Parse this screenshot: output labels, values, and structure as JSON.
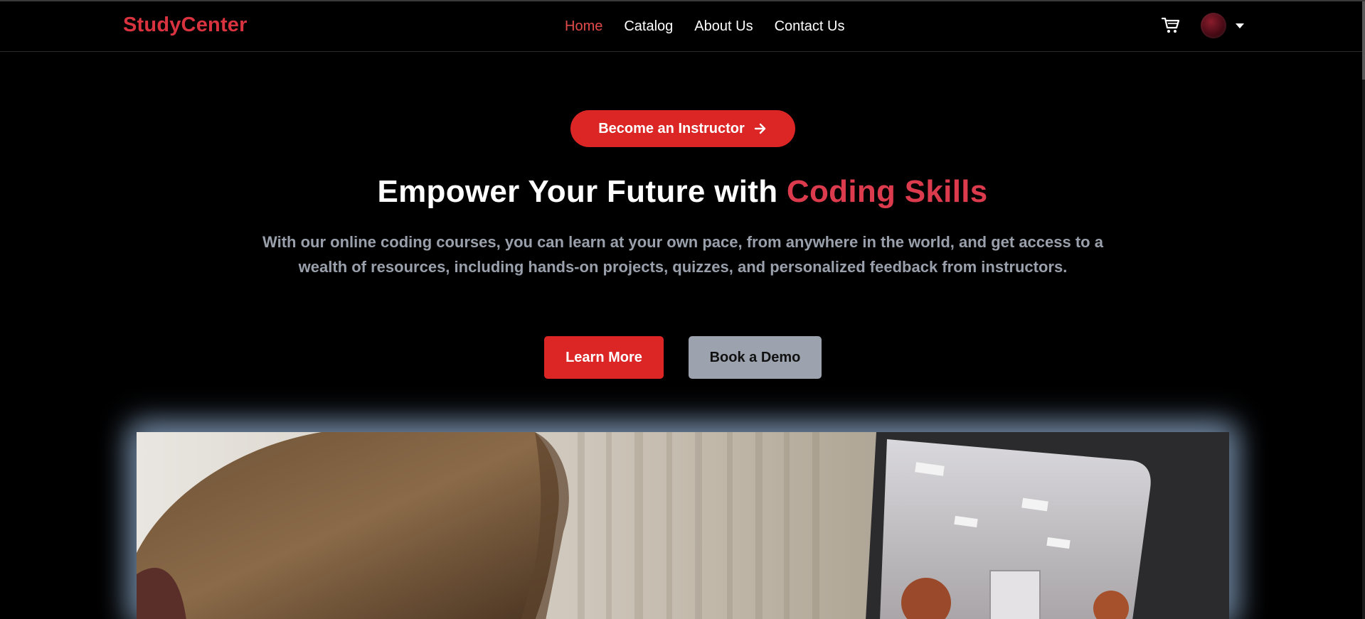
{
  "brand": {
    "name": "StudyCenter",
    "accent_color": "#d8333f",
    "button_color": "#dc2626"
  },
  "nav": {
    "links": [
      {
        "label": "Home",
        "active": true
      },
      {
        "label": "Catalog",
        "active": false
      },
      {
        "label": "About Us",
        "active": false
      },
      {
        "label": "Contact Us",
        "active": false
      }
    ],
    "cart_icon": "cart-icon",
    "avatar_icon": "avatar",
    "dropdown_icon": "caret-down-icon"
  },
  "hero": {
    "badge_label": "Become an Instructor",
    "badge_icon": "arrow-right-icon",
    "headline_main": "Empower Your Future with ",
    "headline_accent": "Coding Skills",
    "subtext": "With our online coding courses, you can learn at your own pace, from anywhere in the world, and get access to a wealth of resources, including hands-on projects, quizzes, and personalized feedback from instructors.",
    "primary_button": "Learn More",
    "secondary_button": "Book a Demo"
  }
}
